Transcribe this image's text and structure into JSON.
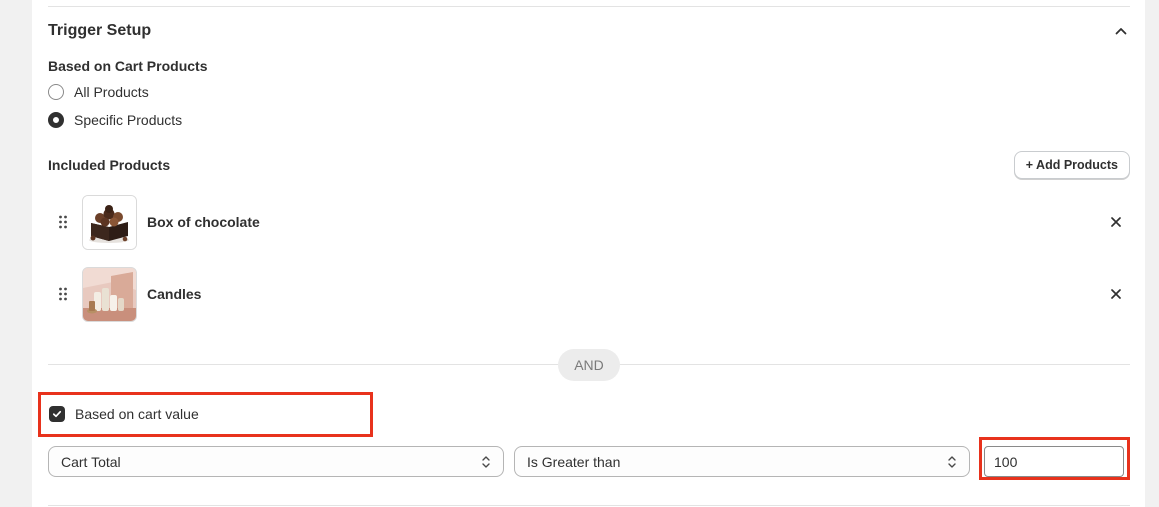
{
  "trigger_setup": {
    "title": "Trigger Setup",
    "cart_products": {
      "label": "Based on Cart Products",
      "options": [
        {
          "label": "All Products",
          "selected": false
        },
        {
          "label": "Specific Products",
          "selected": true
        }
      ]
    },
    "included_products": {
      "label": "Included Products",
      "add_button": "+ Add Products",
      "items": [
        {
          "name": "Box of chocolate",
          "image": "chocolate-box-thumbnail"
        },
        {
          "name": "Candles",
          "image": "candles-thumbnail"
        }
      ]
    },
    "separator": "AND",
    "cart_value": {
      "label": "Based on cart value",
      "checked": true,
      "field_select": "Cart Total",
      "operator_select": "Is Greater than",
      "value": "100"
    }
  },
  "colors": {
    "highlight": "#e8321c",
    "text": "#303030",
    "background": "#f1f1f1"
  }
}
